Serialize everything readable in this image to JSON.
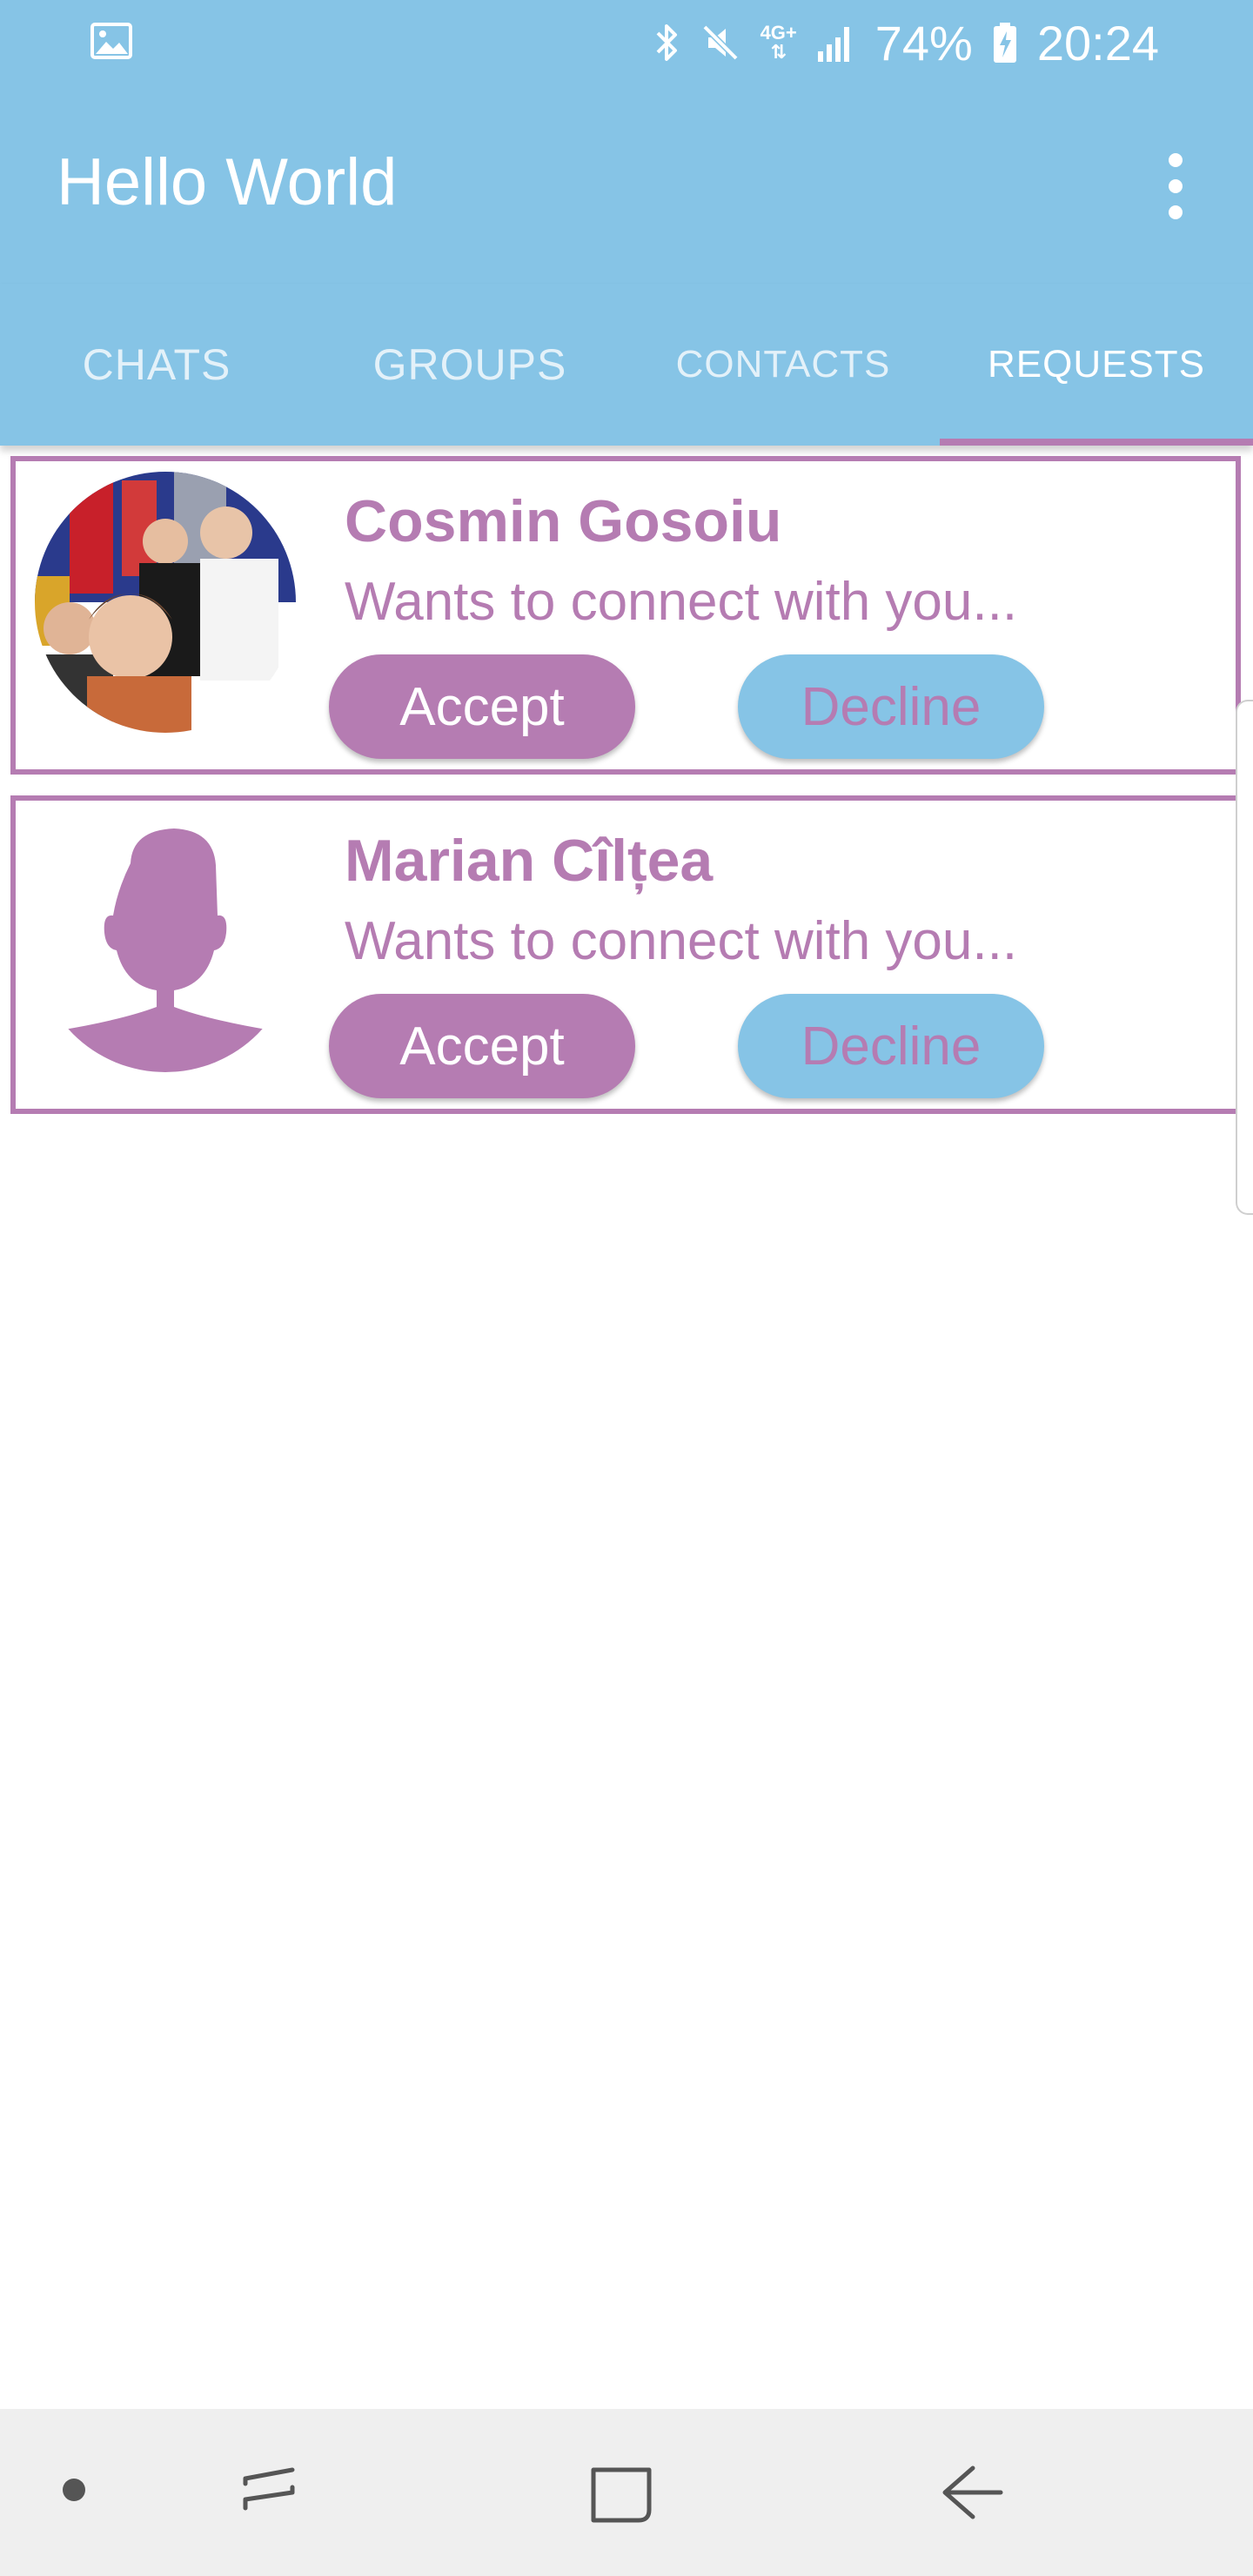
{
  "status_bar": {
    "network": "4G+",
    "battery": "74%",
    "time": "20:24"
  },
  "app_bar": {
    "title": "Hello World"
  },
  "tabs": [
    {
      "label": "CHATS",
      "active": false
    },
    {
      "label": "GROUPS",
      "active": false
    },
    {
      "label": "CONTACTS",
      "active": false
    },
    {
      "label": "REQUESTS",
      "active": true
    }
  ],
  "requests": [
    {
      "name": "Cosmin Gosoiu",
      "message": "Wants to connect with you...",
      "accept_label": "Accept",
      "decline_label": "Decline",
      "avatar": "group-photo"
    },
    {
      "name": "Marian Cîlțea",
      "message": "Wants to connect with you...",
      "accept_label": "Accept",
      "decline_label": "Decline",
      "avatar": "person-silhouette-icon"
    }
  ],
  "colors": {
    "primary": "#86c4e6",
    "accent": "#b57cb2",
    "nav_bar": "#efefef"
  }
}
